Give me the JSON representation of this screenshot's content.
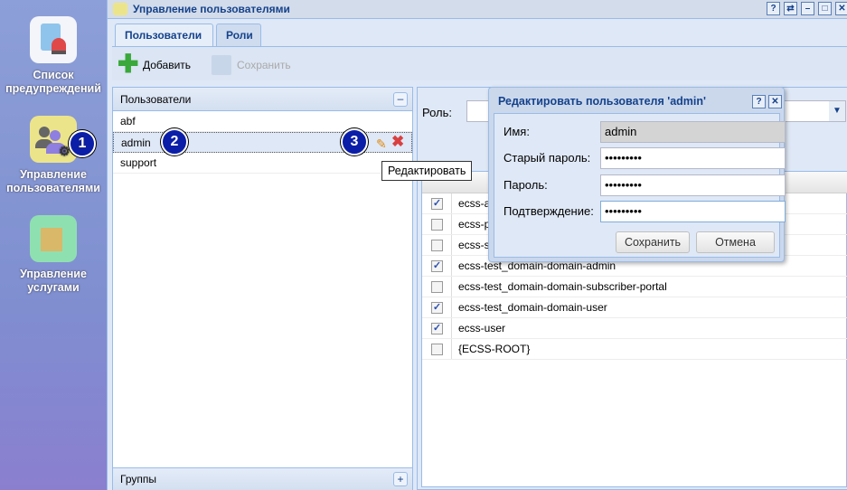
{
  "sidebar": {
    "items": [
      {
        "label": "Список предупреждений",
        "icon": "alarm-list-icon"
      },
      {
        "label": "Управление пользователями",
        "icon": "users-gear-icon",
        "badge": "1"
      },
      {
        "label": "Управление услугами",
        "icon": "services-icon"
      }
    ]
  },
  "window": {
    "title": "Управление пользователями",
    "controls": [
      "?",
      "⇄",
      "–",
      "□",
      "✕"
    ]
  },
  "tabs": [
    {
      "label": "Пользователи",
      "active": true
    },
    {
      "label": "Роли",
      "active": false
    }
  ],
  "toolbar": {
    "add_label": "Добавить",
    "save_label": "Сохранить"
  },
  "users_panel": {
    "title": "Пользователи",
    "users": [
      "abf",
      "admin",
      "support"
    ],
    "selected": "admin",
    "badge2": "2",
    "badge3": "3",
    "groups_title": "Группы"
  },
  "tooltip": "Редактировать",
  "roles_panel": {
    "role_label": "Роль:",
    "rows": [
      {
        "name": "ecss-a",
        "checked": true
      },
      {
        "name": "ecss-p",
        "checked": false
      },
      {
        "name": "ecss-s",
        "checked": false
      },
      {
        "name": "ecss-test_domain-domain-admin",
        "checked": true
      },
      {
        "name": "ecss-test_domain-domain-subscriber-portal",
        "checked": false
      },
      {
        "name": "ecss-test_domain-domain-user",
        "checked": true
      },
      {
        "name": "ecss-user",
        "checked": true
      },
      {
        "name": "{ECSS-ROOT}",
        "checked": false
      }
    ]
  },
  "dialog": {
    "title": "Редактировать пользователя 'admin'",
    "name_label": "Имя:",
    "name_value": "admin",
    "old_pw_label": "Старый пароль:",
    "old_pw_value": "•••••••••",
    "pw_label": "Пароль:",
    "pw_value": "•••••••••",
    "confirm_label": "Подтверждение:",
    "confirm_value": "•••••••••",
    "save": "Сохранить",
    "cancel": "Отмена"
  }
}
